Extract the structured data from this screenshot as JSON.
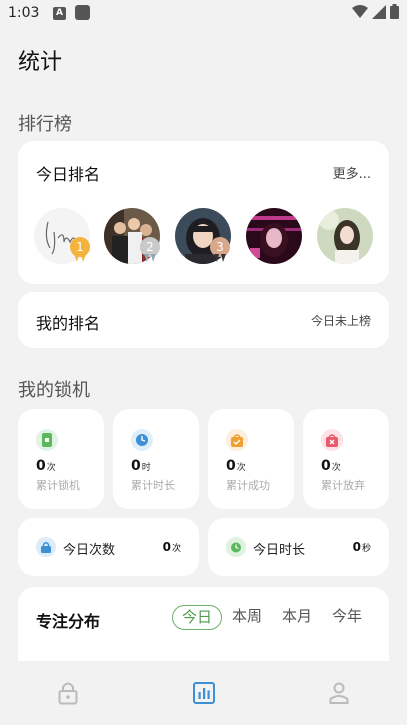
{
  "status_bar": {
    "time": "1:03",
    "notification_letter": "A"
  },
  "page": {
    "title": "统计"
  },
  "leaderboard": {
    "section_title": "排行榜",
    "card_title": "今日排名",
    "more_label": "更多...",
    "ranks": [
      "1",
      "2",
      "3"
    ]
  },
  "my_rank": {
    "label": "我的排名",
    "status": "今日未上榜"
  },
  "my_lock": {
    "section_title": "我的锁机",
    "stats": [
      {
        "value": "0",
        "unit": "次",
        "label": "累计锁机",
        "icon": "phone-lock-icon",
        "color": "#5cb85c"
      },
      {
        "value": "0",
        "unit": "时",
        "label": "累计时长",
        "icon": "clock-icon",
        "color": "#3d8fd6"
      },
      {
        "value": "0",
        "unit": "次",
        "label": "累计成功",
        "icon": "success-bag-icon",
        "color": "#f0a030"
      },
      {
        "value": "0",
        "unit": "次",
        "label": "累计放弃",
        "icon": "quit-bag-icon",
        "color": "#e85a6a"
      }
    ],
    "today_count": {
      "label": "今日次数",
      "value": "0",
      "unit": "次"
    },
    "today_duration": {
      "label": "今日时长",
      "value": "0",
      "unit": "秒"
    }
  },
  "focus": {
    "title": "专注分布",
    "tabs": [
      "今日",
      "本周",
      "本月",
      "今年"
    ],
    "active_tab": "今日"
  },
  "bottom_nav": {
    "items": [
      "lock-icon",
      "stats-icon",
      "profile-icon"
    ],
    "active_color": "#3d8fd6"
  }
}
